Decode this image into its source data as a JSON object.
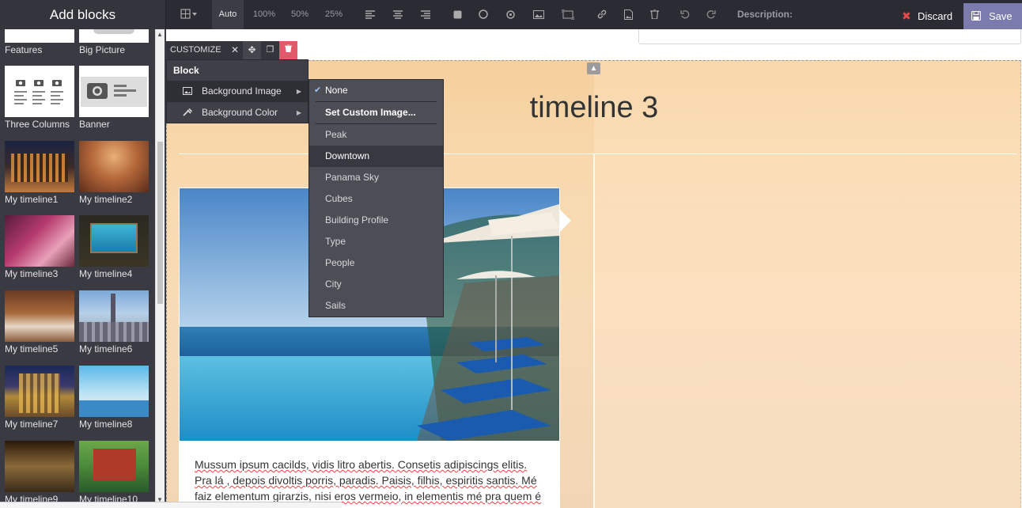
{
  "topbar": {
    "add_blocks": "Add blocks",
    "zoom": [
      "Auto",
      "100%",
      "50%",
      "25%"
    ],
    "description_label": "Description:",
    "discard_label": "Discard",
    "save_label": "Save"
  },
  "left_panel": {
    "blocks": [
      {
        "label": "Features"
      },
      {
        "label": "Big Picture"
      },
      {
        "label": "Three Columns"
      },
      {
        "label": "Banner"
      },
      {
        "label": "My timeline1"
      },
      {
        "label": "My timeline2"
      },
      {
        "label": "My timeline3"
      },
      {
        "label": "My timeline4"
      },
      {
        "label": "My timeline5"
      },
      {
        "label": "My timeline6"
      },
      {
        "label": "My timeline7"
      },
      {
        "label": "My timeline8"
      },
      {
        "label": "My timeline9"
      },
      {
        "label": "My timeline10"
      }
    ]
  },
  "customize": {
    "label": "CUSTOMIZE",
    "menu_title": "Block",
    "items": [
      {
        "label": "Background Image"
      },
      {
        "label": "Background Color"
      }
    ]
  },
  "background_submenu": {
    "items": [
      {
        "label": "None",
        "checked": true
      },
      {
        "label": "Set Custom Image..."
      },
      {
        "label": "Peak"
      },
      {
        "label": "Downtown",
        "selected": true
      },
      {
        "label": "Panama Sky"
      },
      {
        "label": "Cubes"
      },
      {
        "label": "Building Profile"
      },
      {
        "label": "Type"
      },
      {
        "label": "People"
      },
      {
        "label": "City"
      },
      {
        "label": "Sails"
      }
    ]
  },
  "content": {
    "title": "timeline 3",
    "card_text_lines": [
      "Mussum ipsum cacilds, vidis litro abertis. Consetis adipiscings elitis.",
      "Pra lá , depois divoltis porris, paradis. Paisis, filhis, espiritis santis. Mé",
      "faiz elementum girarzis, nisi eros vermeio, in elementis mé pra quem é"
    ]
  },
  "colors": {
    "topbar": "#2b2b33",
    "save": "#7c7bad",
    "discard_icon": "#e24a4a",
    "delete": "#e05a6a"
  }
}
